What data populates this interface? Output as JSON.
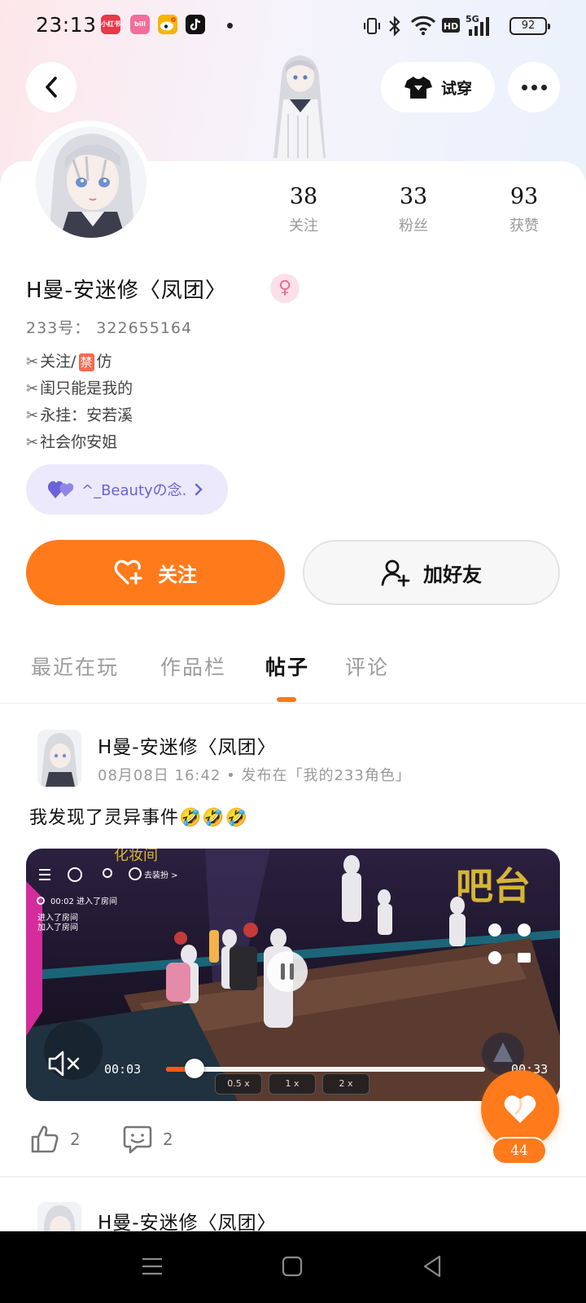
{
  "status_bar": {
    "time": "23:13",
    "battery": "92",
    "app_icons": [
      {
        "name": "xiaohongshu-icon",
        "color": "#e8384a",
        "label": "小红书"
      },
      {
        "name": "bilibili-icon",
        "color": "#f36c9c",
        "label": "bili"
      },
      {
        "name": "weibo-icon",
        "color": "#f7b500",
        "label": ""
      },
      {
        "name": "tiktok-icon",
        "color": "#111111",
        "label": ""
      }
    ]
  },
  "header": {
    "tryon_label": "试穿"
  },
  "profile": {
    "stats": [
      {
        "value": "38",
        "label": "关注"
      },
      {
        "value": "33",
        "label": "粉丝"
      },
      {
        "value": "93",
        "label": "获赞"
      }
    ],
    "username": "H曼-安迷修〈凤团〉",
    "gender": "♀",
    "uid": "233号： 322655164",
    "bio": {
      "line1_pre": "关注/",
      "line1_ban": "禁",
      "line1_post": "仿",
      "line2": "闺只能是我的",
      "line3": "永挂：安若溪",
      "line4": "社会你安姐"
    },
    "bond": "^_Beautyの念.",
    "follow_label": "关注",
    "add_friend_label": "加好友"
  },
  "tabs": [
    {
      "label": "最近在玩",
      "active": false
    },
    {
      "label": "作品栏",
      "active": false
    },
    {
      "label": "帖子",
      "active": true
    },
    {
      "label": "评论",
      "active": false
    }
  ],
  "post": {
    "author": "H曼-安迷修〈凤团〉",
    "meta": "08月08日 16:42 • 发布在「我的233角色」",
    "text": "我发现了灵异事件🤣🤣🤣",
    "video": {
      "current_time": "00:03",
      "duration": "00:33",
      "progress": 0.09,
      "speeds": [
        "0.5 x",
        "1 x",
        "2 x"
      ],
      "overlay_sign": "吧台",
      "overlay_top": "化妆间",
      "overlay_left": "去装扮 >",
      "overlay_chat": [
        "00:02 进入了房间",
        "进入了房间",
        "加入了房间"
      ]
    },
    "likes": "2",
    "comments": "2"
  },
  "fab": {
    "count": "44"
  },
  "next_post": {
    "author": "H曼-安迷修〈凤团〉"
  },
  "colors": {
    "accent": "#ff7a1a",
    "bond": "#6b62d9",
    "gender": "#f06a96"
  }
}
